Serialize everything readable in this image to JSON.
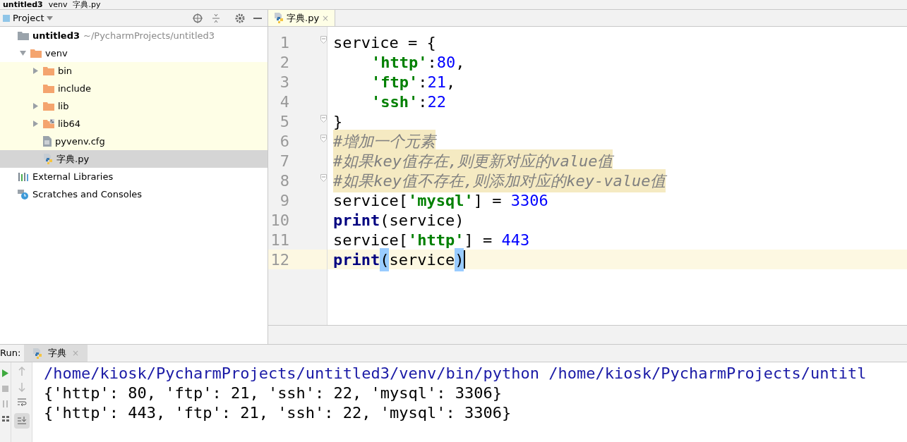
{
  "breadcrumbs": [
    "untitled3",
    "venv",
    "字典.py"
  ],
  "project_panel": {
    "title": "Project"
  },
  "tree": [
    {
      "label": "untitled3",
      "path": "~/PycharmProjects/untitled3",
      "kind": "project",
      "selected": false,
      "children": [
        {
          "label": "venv",
          "kind": "folder",
          "expanded": true,
          "selected": false,
          "children": [
            {
              "label": "bin",
              "kind": "folder",
              "expanded": false,
              "selected": false
            },
            {
              "label": "include",
              "kind": "folder",
              "selected": false
            },
            {
              "label": "lib",
              "kind": "folder",
              "expanded": false,
              "selected": false
            },
            {
              "label": "lib64",
              "kind": "link_folder",
              "expanded": false,
              "selected": false
            },
            {
              "label": "pyvenv.cfg",
              "kind": "text_file",
              "selected": false
            },
            {
              "label": "字典.py",
              "kind": "python_file",
              "selected": true
            }
          ]
        }
      ]
    },
    {
      "label": "External Libraries",
      "kind": "libraries",
      "selected": false
    },
    {
      "label": "Scratches and Consoles",
      "kind": "scratches",
      "selected": false
    }
  ],
  "editor_tabs": [
    {
      "label": "字典.py",
      "close": "×",
      "selected": true
    }
  ],
  "code_lines": [
    {
      "number": "1",
      "fold": true,
      "current": false,
      "tokens": [
        {
          "kind": "plain",
          "text": "service = {"
        }
      ]
    },
    {
      "number": "2",
      "fold": false,
      "current": false,
      "indent": true,
      "tokens": [
        {
          "kind": "string",
          "text": "'http'"
        },
        {
          "kind": "plain",
          "text": ":"
        },
        {
          "kind": "number",
          "text": "80"
        },
        {
          "kind": "plain",
          "text": ","
        }
      ]
    },
    {
      "number": "3",
      "fold": false,
      "current": false,
      "indent": true,
      "tokens": [
        {
          "kind": "string",
          "text": "'ftp'"
        },
        {
          "kind": "plain",
          "text": ":"
        },
        {
          "kind": "number",
          "text": "21"
        },
        {
          "kind": "plain",
          "text": ","
        }
      ]
    },
    {
      "number": "4",
      "fold": false,
      "current": false,
      "indent": true,
      "tokens": [
        {
          "kind": "string",
          "text": "'ssh'"
        },
        {
          "kind": "plain",
          "text": ":"
        },
        {
          "kind": "number",
          "text": "22"
        }
      ]
    },
    {
      "number": "5",
      "fold": true,
      "current": false,
      "tokens": [
        {
          "kind": "plain",
          "text": "}"
        }
      ]
    },
    {
      "number": "6",
      "fold": true,
      "current": false,
      "tokens": [
        {
          "kind": "comment",
          "text": "#增加一个元素"
        }
      ]
    },
    {
      "number": "7",
      "fold": false,
      "current": false,
      "tokens": [
        {
          "kind": "comment",
          "text": "#如果key值存在,则更新对应的value值"
        }
      ]
    },
    {
      "number": "8",
      "fold": true,
      "current": false,
      "tokens": [
        {
          "kind": "comment",
          "text": "#如果key值不存在,则添加对应的key-value值"
        }
      ]
    },
    {
      "number": "9",
      "fold": false,
      "current": false,
      "tokens": [
        {
          "kind": "plain",
          "text": "service["
        },
        {
          "kind": "string",
          "text": "'mysql'"
        },
        {
          "kind": "plain",
          "text": "] = "
        },
        {
          "kind": "number",
          "text": "3306"
        }
      ]
    },
    {
      "number": "10",
      "fold": false,
      "current": false,
      "tokens": [
        {
          "kind": "keyword",
          "text": "print"
        },
        {
          "kind": "plain",
          "text": "(service)"
        }
      ]
    },
    {
      "number": "11",
      "fold": false,
      "current": false,
      "tokens": [
        {
          "kind": "plain",
          "text": "service["
        },
        {
          "kind": "string",
          "text": "'http'"
        },
        {
          "kind": "plain",
          "text": "] = "
        },
        {
          "kind": "number",
          "text": "443"
        }
      ]
    },
    {
      "number": "12",
      "fold": false,
      "current": true,
      "tokens": [
        {
          "kind": "keyword",
          "text": "print"
        },
        {
          "kind": "match",
          "text": "("
        },
        {
          "kind": "plain",
          "text": "service"
        },
        {
          "kind": "match",
          "text": ")"
        }
      ]
    }
  ],
  "run_panel": {
    "label": "Run:",
    "tabs": [
      {
        "label": "字典",
        "close": "×",
        "selected": true
      }
    ]
  },
  "console_lines": [
    {
      "kind": "command",
      "text": "/home/kiosk/PycharmProjects/untitled3/venv/bin/python /home/kiosk/PycharmProjects/untitl"
    },
    {
      "kind": "output",
      "text": "{'http': 80, 'ftp': 21, 'ssh': 22, 'mysql': 3306}"
    },
    {
      "kind": "output",
      "text": "{'http': 443, 'ftp': 21, 'ssh': 22, 'mysql': 3306}"
    }
  ]
}
